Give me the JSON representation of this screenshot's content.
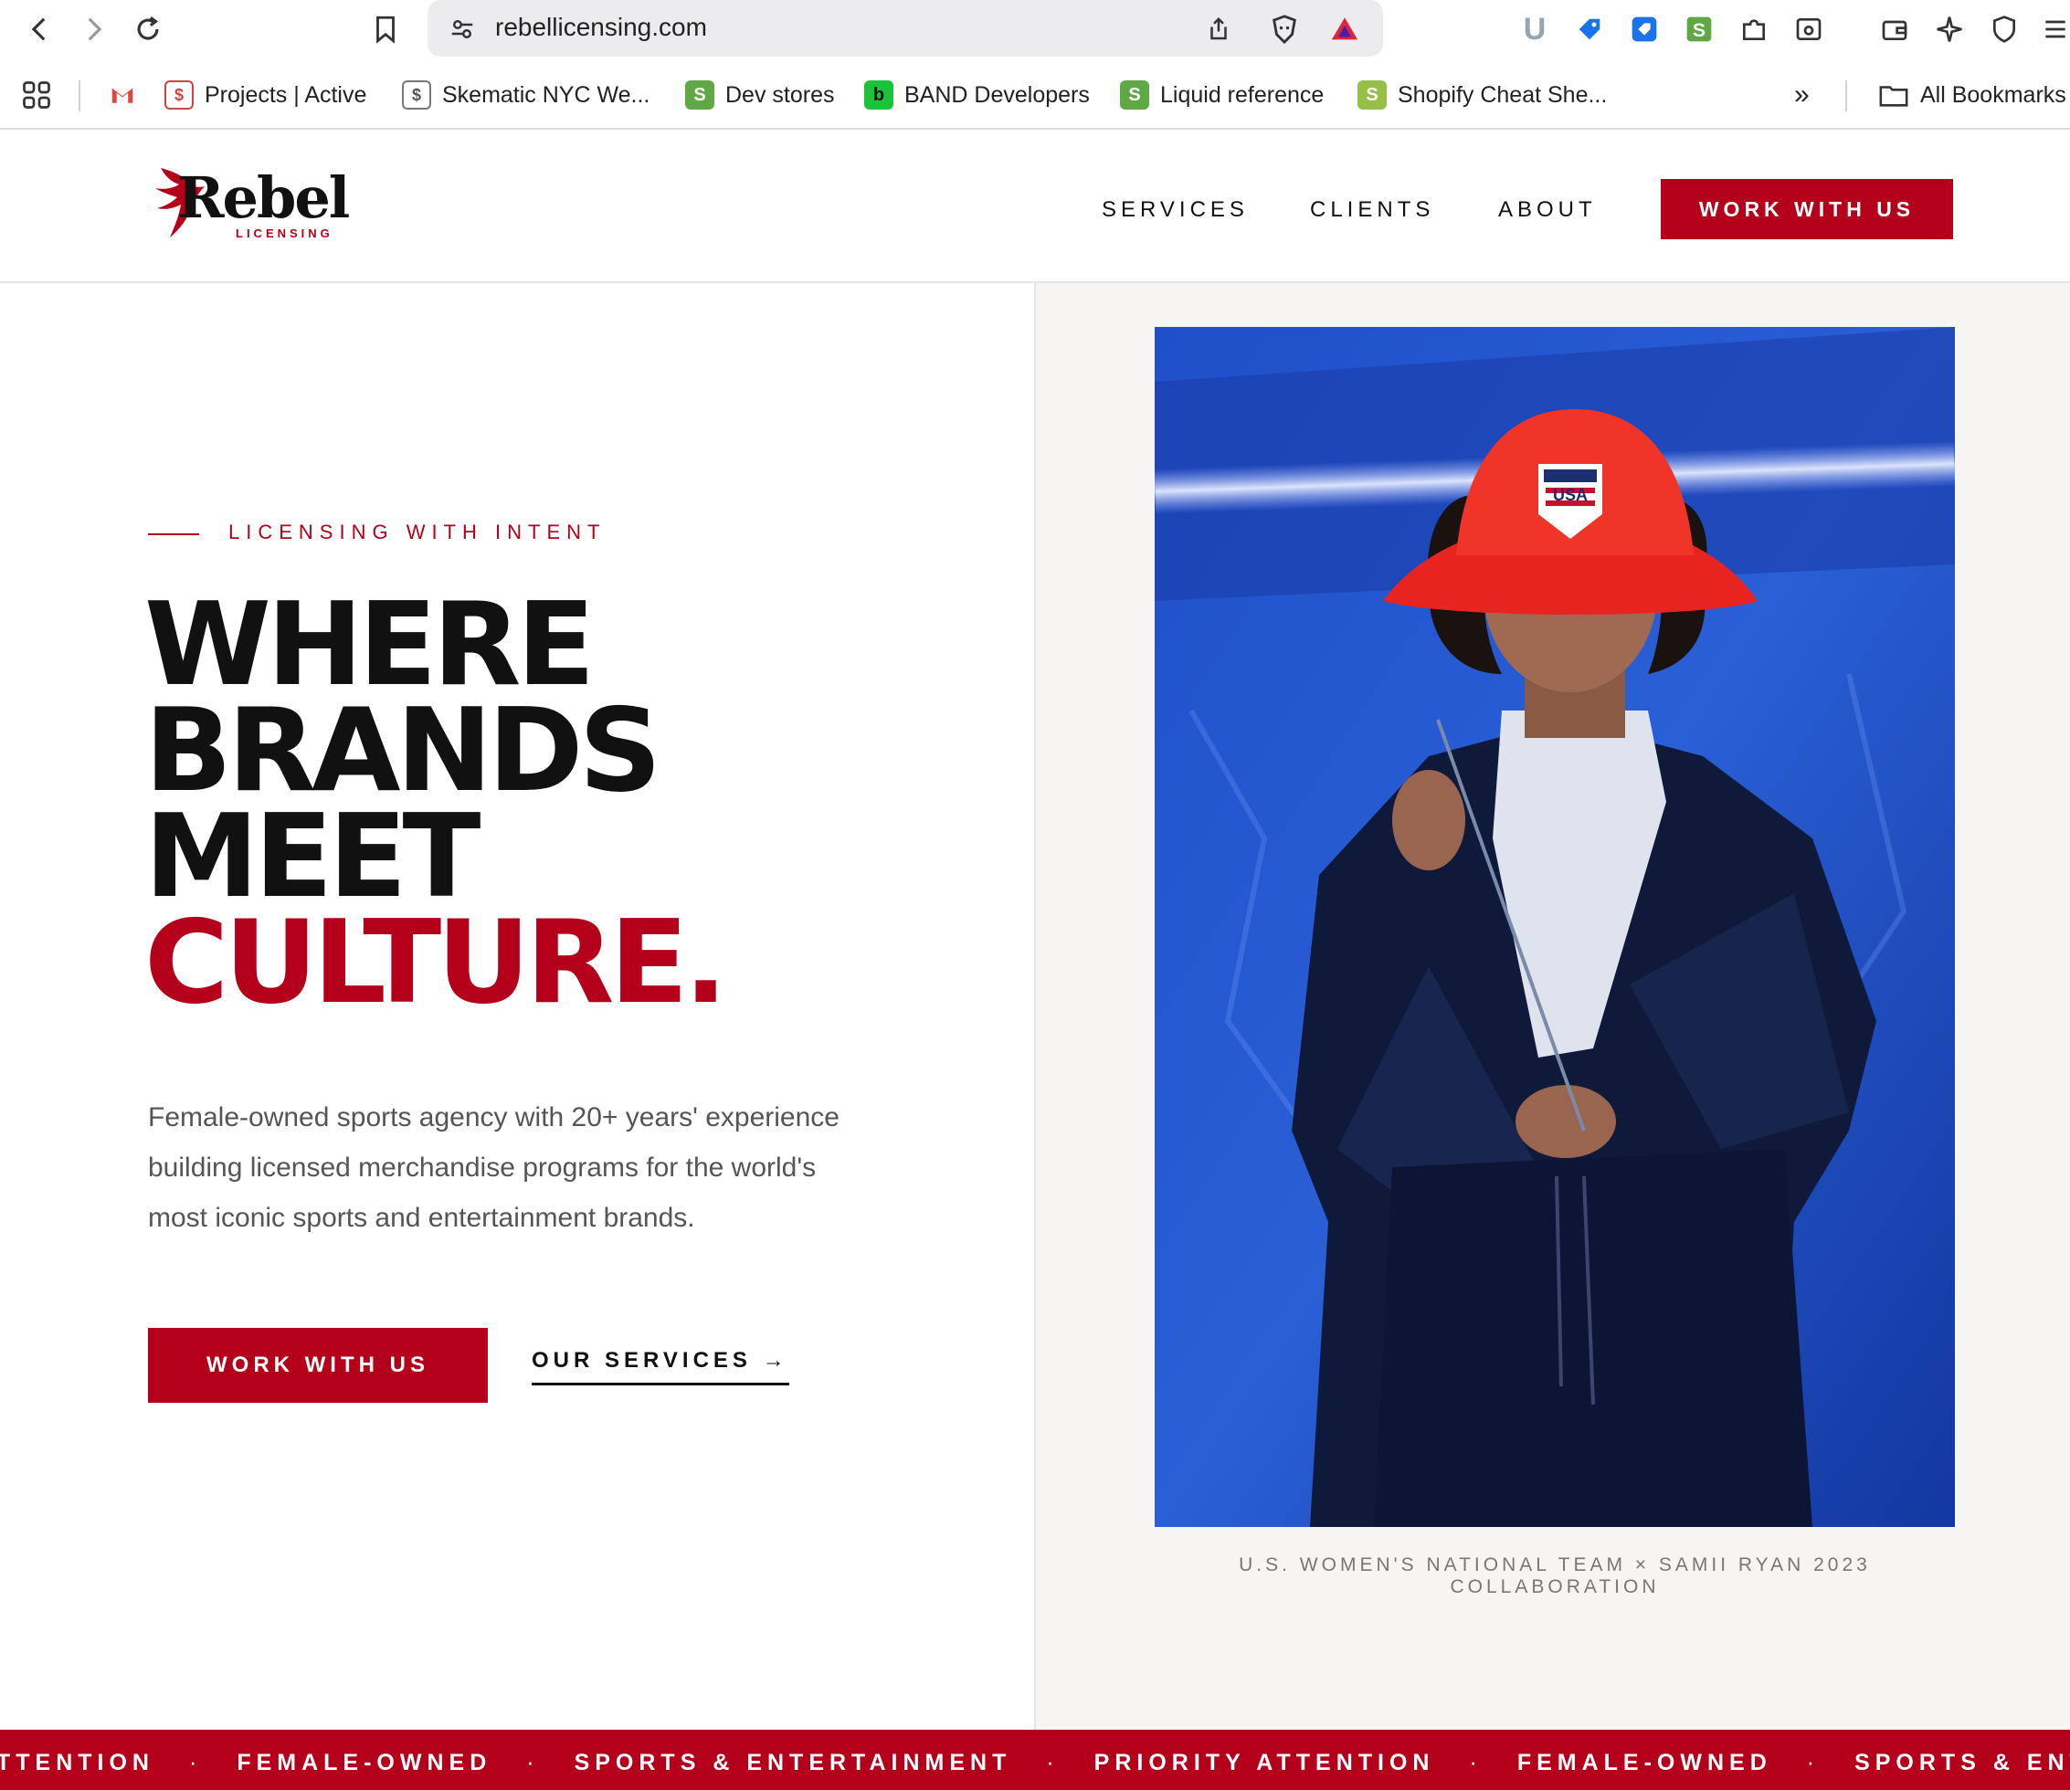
{
  "browser": {
    "url": "rebellicensing.com",
    "bookmarks": [
      {
        "label": "",
        "icon": "gmail-icon"
      },
      {
        "label": "Projects | Active",
        "icon": "projects-favicon"
      },
      {
        "label": "Skematic NYC We...",
        "icon": "skematic-favicon"
      },
      {
        "label": "Dev stores",
        "icon": "shopify-favicon"
      },
      {
        "label": "BAND Developers",
        "icon": "band-favicon"
      },
      {
        "label": "Liquid reference",
        "icon": "shopify-favicon"
      },
      {
        "label": "Shopify Cheat She...",
        "icon": "shopify-favicon"
      }
    ],
    "all_bookmarks": "All Bookmarks",
    "more": "»"
  },
  "site": {
    "logo_text": "Rebel",
    "logo_sub": "LICENSING",
    "nav": [
      "SERVICES",
      "CLIENTS",
      "ABOUT"
    ],
    "cta_top": "WORK WITH US"
  },
  "hero": {
    "eyebrow": "LICENSING WITH INTENT",
    "headline_lines": [
      "WHERE",
      "BRANDS",
      "MEET"
    ],
    "headline_accent": "CULTURE.",
    "lede": "Female-owned sports agency with 20+ years' experience building licensed merchandise programs for the world's most iconic sports and entertainment brands.",
    "cta_primary": "WORK WITH US",
    "cta_secondary": "OUR SERVICES →",
    "caption_line1": "U.S. WOMEN'S NATIONAL TEAM × SAMII RYAN 2023",
    "caption_line2": "COLLABORATION",
    "hat_badge": "USA"
  },
  "ticker": {
    "items": [
      "TTENTION",
      "FEMALE-OWNED",
      "SPORTS & ENTERTAINMENT",
      "PRIORITY ATTENTION",
      "FEMALE-OWNED",
      "SPORTS & ENTE"
    ],
    "separator": "·"
  },
  "colors": {
    "brand_red": "#b5001b",
    "text_dark": "#111111",
    "photo_blue": "#1b4fc4"
  }
}
